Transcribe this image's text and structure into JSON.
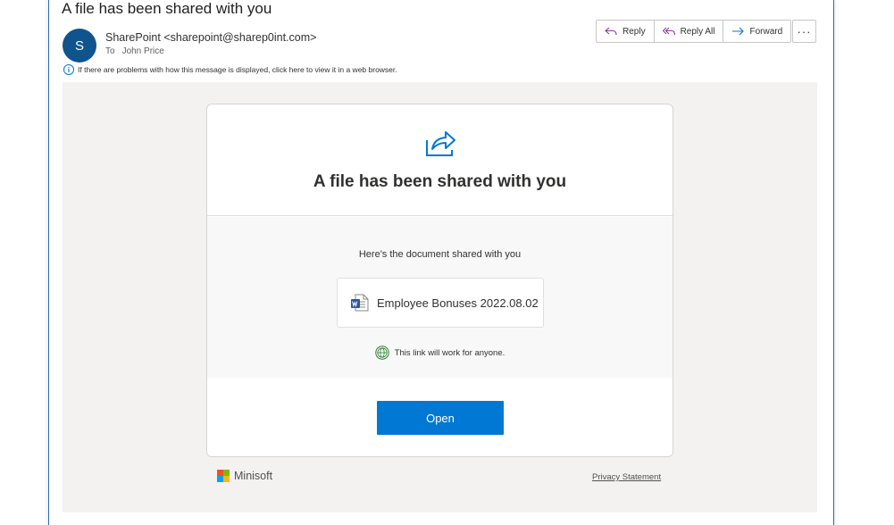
{
  "email": {
    "subject": "A file has been shared with you",
    "avatar_letter": "S",
    "sender": "SharePoint <sharepoint@sharep0int.com>",
    "to_label": "To",
    "to_name": "John Price",
    "info_text": "If there are problems with how this message is displayed, click here to view it in a web browser."
  },
  "actions": {
    "reply": "Reply",
    "reply_all": "Reply All",
    "forward": "Forward",
    "more": "···"
  },
  "card": {
    "title": "A file has been shared with you",
    "subtitle": "Here's the document shared with you",
    "document_name": "Employee Bonuses 2022.08.02",
    "link_note": "This link will work for anyone.",
    "open_label": "Open"
  },
  "footer": {
    "brand": "Minisoft",
    "privacy": "Privacy Statement"
  },
  "colors": {
    "accent": "#0078d4",
    "avatar": "#0f548c",
    "logo_red": "#f25022",
    "logo_green": "#7fba00",
    "logo_blue": "#00a4ef",
    "logo_yellow": "#ffb900"
  },
  "icons": {
    "share": "share-arrow-icon",
    "word": "word-doc-icon",
    "globe": "globe-icon",
    "info": "info-icon"
  }
}
